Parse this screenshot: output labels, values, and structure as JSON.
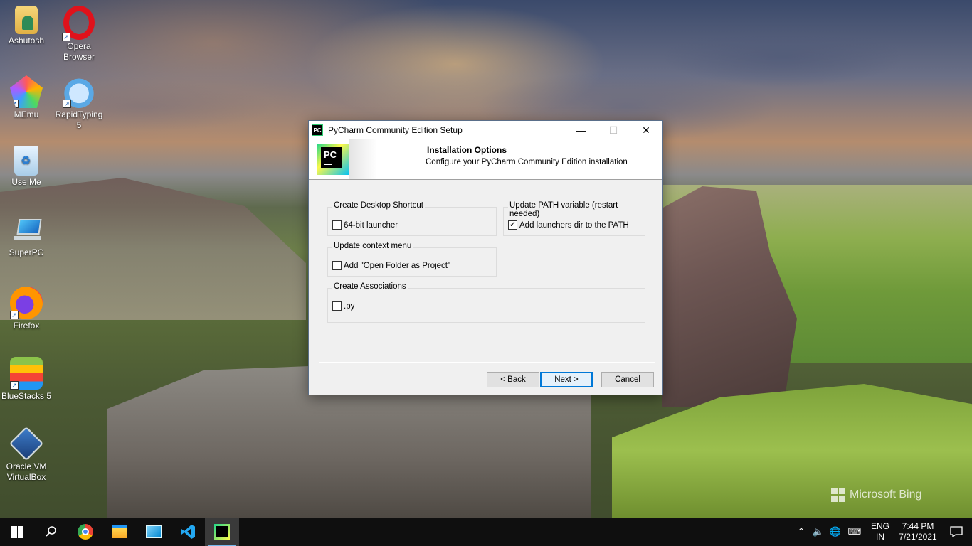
{
  "desktop": {
    "icons": [
      {
        "label": "Ashutosh",
        "icon": "user-folder-icon"
      },
      {
        "label": "Opera Browser",
        "icon": "opera-icon"
      },
      {
        "label": "MEmu",
        "icon": "memu-icon"
      },
      {
        "label": "RapidTyping 5",
        "icon": "rapidtyping-icon"
      },
      {
        "label": "Use Me",
        "icon": "recycle-bin-icon"
      },
      {
        "label": "SuperPC",
        "icon": "this-pc-icon"
      },
      {
        "label": "Firefox",
        "icon": "firefox-icon"
      },
      {
        "label": "BlueStacks 5",
        "icon": "bluestacks-icon"
      },
      {
        "label": "Oracle VM VirtualBox",
        "icon": "virtualbox-icon"
      }
    ],
    "watermark": "Microsoft Bing"
  },
  "dialog": {
    "app_icon_text": "PC",
    "title": "PyCharm Community Edition Setup",
    "header_title": "Installation Options",
    "header_subtitle": "Configure your PyCharm Community Edition installation",
    "logo_text": "PC",
    "groups": {
      "desktop_shortcut": {
        "label": "Create Desktop Shortcut",
        "option": {
          "label": "64-bit launcher",
          "checked": false
        }
      },
      "update_path": {
        "label": "Update PATH variable (restart needed)",
        "option": {
          "label": "Add launchers dir to the PATH",
          "checked": true
        }
      },
      "context_menu": {
        "label": "Update context menu",
        "option": {
          "label": "Add \"Open Folder as Project\"",
          "checked": false
        }
      },
      "associations": {
        "label": "Create Associations",
        "option": {
          "label": ".py",
          "checked": false
        }
      }
    },
    "buttons": {
      "back": "< Back",
      "next": "Next >",
      "cancel": "Cancel"
    }
  },
  "taskbar": {
    "apps": [
      "start-icon",
      "search-icon",
      "chrome-icon",
      "file-explorer-icon",
      "control-panel-icon",
      "vscode-icon",
      "pycharm-icon"
    ],
    "lang_line1": "ENG",
    "lang_line2": "IN",
    "time": "7:44 PM",
    "date": "7/21/2021"
  },
  "colors": {
    "accent": "#0078d7",
    "taskbar": "#0f0f0f",
    "dialog_bg": "#f0f0f0"
  }
}
